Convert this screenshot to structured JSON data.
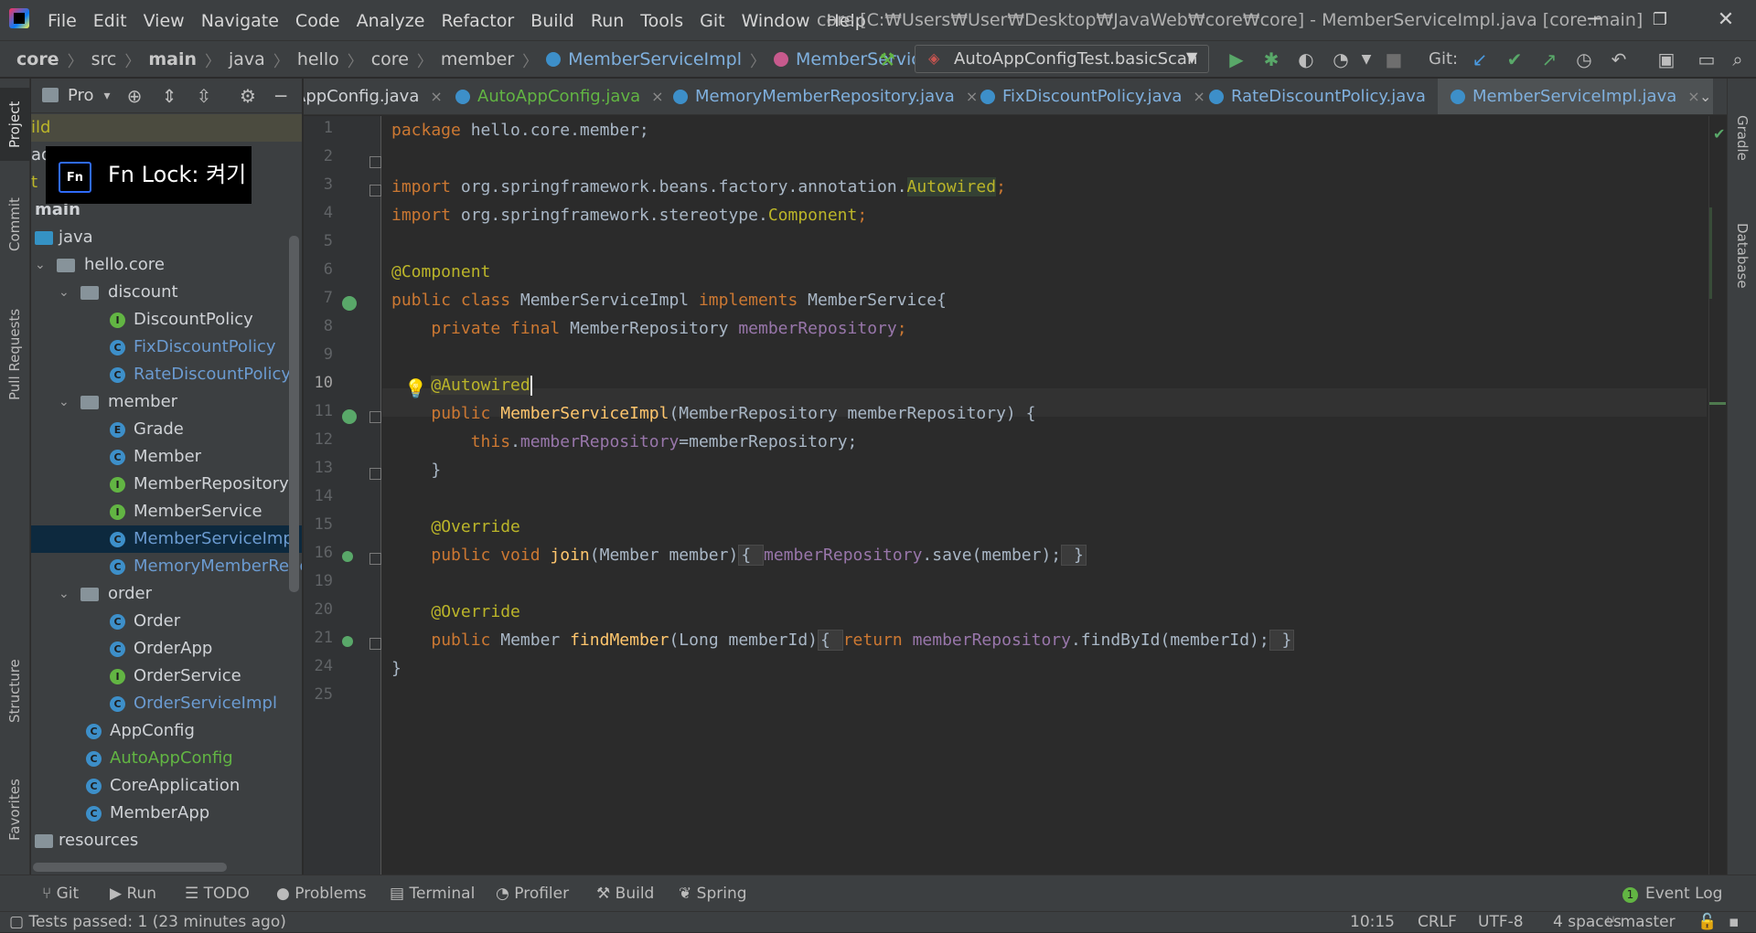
{
  "window": {
    "title": "core [C:₩Users₩User₩Desktop₩JavaWeb₩core₩core] - MemberServiceImpl.java [core.main]",
    "minimize": "─",
    "restore": "❐",
    "close": "✕"
  },
  "menu": [
    "File",
    "Edit",
    "View",
    "Navigate",
    "Code",
    "Analyze",
    "Refactor",
    "Build",
    "Run",
    "Tools",
    "Git",
    "Window",
    "Help"
  ],
  "breadcrumb": [
    "core",
    "src",
    "main",
    "java",
    "hello",
    "core",
    "member",
    "MemberServiceImpl",
    "MemberServiceImpl"
  ],
  "run_config": {
    "label": "AutoAppConfigTest.basicScan"
  },
  "git_label": "Git:",
  "left_stripe": [
    "Project",
    "Commit",
    "Pull Requests",
    "Structure",
    "Favorites"
  ],
  "right_stripe": [
    "Gradle",
    "Database"
  ],
  "project_panel": {
    "title": "Pro"
  },
  "fn_lock": {
    "badge": "Fn",
    "text": "Fn  Lock: 켜기"
  },
  "tree": [
    {
      "label": "ild",
      "color": "#bbb529"
    },
    {
      "label": "adl",
      "color": "#cfd2d6"
    },
    {
      "label": "t",
      "color": "#bbb529"
    },
    {
      "label": "main",
      "bold": true
    },
    {
      "label": "java"
    },
    {
      "label": "hello.core"
    },
    {
      "label": "discount"
    },
    {
      "label": "DiscountPolicy",
      "icon": "I"
    },
    {
      "label": "FixDiscountPolicy",
      "icon": "C",
      "color": "#6b9bd1"
    },
    {
      "label": "RateDiscountPolicy",
      "icon": "C",
      "color": "#6b9bd1"
    },
    {
      "label": "member"
    },
    {
      "label": "Grade",
      "icon": "E"
    },
    {
      "label": "Member",
      "icon": "C"
    },
    {
      "label": "MemberRepository",
      "icon": "I"
    },
    {
      "label": "MemberService",
      "icon": "I"
    },
    {
      "label": "MemberServiceImpl",
      "icon": "C",
      "color": "#6b9bd1"
    },
    {
      "label": "MemoryMemberRepos",
      "icon": "C",
      "color": "#6b9bd1"
    },
    {
      "label": "order"
    },
    {
      "label": "Order",
      "icon": "C"
    },
    {
      "label": "OrderApp",
      "icon": "C"
    },
    {
      "label": "OrderService",
      "icon": "I"
    },
    {
      "label": "OrderServiceImpl",
      "icon": "C",
      "color": "#6b9bd1"
    },
    {
      "label": "AppConfig",
      "icon": "C"
    },
    {
      "label": "AutoAppConfig",
      "icon": "C",
      "color": "#62b543"
    },
    {
      "label": "CoreApplication",
      "icon": "C"
    },
    {
      "label": "MemberApp",
      "icon": "C"
    },
    {
      "label": "resources"
    }
  ],
  "tabs": [
    {
      "label": "AppConfig.java"
    },
    {
      "label": "AutoAppConfig.java"
    },
    {
      "label": "MemoryMemberRepository.java"
    },
    {
      "label": "FixDiscountPolicy.java"
    },
    {
      "label": "RateDiscountPolicy.java"
    },
    {
      "label": "MemberServiceImpl.java"
    }
  ],
  "tab_close": "×",
  "line_numbers": [
    "1",
    "2",
    "3",
    "4",
    "5",
    "6",
    "7",
    "8",
    "9",
    "10",
    "11",
    "12",
    "13",
    "14",
    "15",
    "16",
    "19",
    "20",
    "21",
    "24",
    "25"
  ],
  "code": {
    "l1_kw": "package",
    "l1_rest": " hello.core.member;",
    "l3_kw": "import",
    "l3_rest": " org.springframework.beans.factory.annotation.",
    "l3_cls": "Autowired",
    "l3_end": ";",
    "l4_kw": "import",
    "l4_rest": " org.springframework.stereotype.",
    "l4_cls": "Component",
    "l4_end": ";",
    "l6_ann": "@Component",
    "l7_kw": "public class",
    "l7_name": " MemberServiceImpl ",
    "l7_kw2": "implements",
    "l7_rest": " MemberService{",
    "l8_kw": "private final",
    "l8_type": " MemberRepository ",
    "l8_fld": "memberRepository",
    "l8_end": ";",
    "l10_ann": "@Autowired",
    "l11_kw": "public",
    "l11_fn": " MemberServiceImpl",
    "l11_rest": "(MemberRepository memberRepository) {",
    "l12_kw": "this",
    "l12_dot": ".",
    "l12_fld": "memberRepository",
    "l12_rest": "=memberRepository;",
    "l13": "}",
    "l15_ann": "@Override",
    "l16_kw": "public void",
    "l16_fn": " join",
    "l16_rest": "(Member member)",
    "l16_open": "{ ",
    "l16_fld": "memberRepository",
    "l16_call": ".save(member);",
    "l16_close": " }",
    "l20_ann": "@Override",
    "l21_kw": "public",
    "l21_type": " Member ",
    "l21_fn": "findMember",
    "l21_rest": "(Long memberId)",
    "l21_open": "{ ",
    "l21_ret": "return ",
    "l21_fld": "memberRepository",
    "l21_call": ".findById(memberId);",
    "l21_close": " }",
    "l24": "}"
  },
  "bottom_tools": [
    "Git",
    "Run",
    "TODO",
    "Problems",
    "Terminal",
    "Profiler",
    "Build",
    "Spring"
  ],
  "event_log": {
    "count": "1",
    "label": "Event Log"
  },
  "status": {
    "message": "Tests passed: 1 (23 minutes ago)",
    "position": "10:15",
    "line_sep": "CRLF",
    "encoding": "UTF-8",
    "indent": "4 spaces",
    "branch": "master"
  }
}
